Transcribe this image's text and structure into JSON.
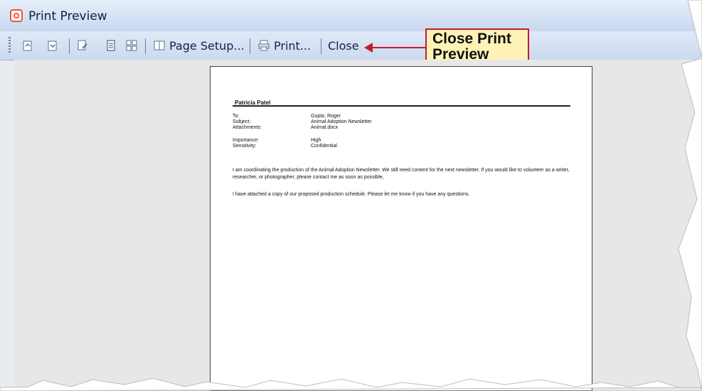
{
  "window": {
    "title": "Print Preview"
  },
  "toolbar": {
    "page_setup_label": "Page Setup...",
    "print_label": "Print...",
    "close_label": "Close"
  },
  "callout": {
    "text_line1": "Close Print",
    "text_line2": "Preview"
  },
  "document": {
    "author": "Patricia Patel",
    "fields": [
      {
        "label": "To:",
        "value": "Gupta, Roger"
      },
      {
        "label": "Subject:",
        "value": "Animal Adoption Newsletter"
      },
      {
        "label": "Attachments:",
        "value": "Animal.docx"
      },
      {
        "label": "Importance:",
        "value": "High"
      },
      {
        "label": "Sensitivity:",
        "value": "Confidential"
      }
    ],
    "paragraph1": "I am coordinating the production of the Animal Adoption Newsletter. We still need content for the next newsletter. If you would like to volunteer as a writer, researcher, or photographer, please contact me as soon as possible,",
    "paragraph2": "I have attached a copy of our proposed production schedule. Please let me know if you have any questions."
  },
  "icons": {
    "app": "print-preview-app-icon",
    "page_up": "previous-page-icon",
    "page_down": "next-page-icon",
    "view_one_page": "single-page-icon",
    "view_multi_page": "multiple-pages-icon",
    "page_setup": "page-setup-icon",
    "print": "printer-icon",
    "overflow": "overflow-chevron-icon"
  },
  "colors": {
    "titlebar_top": "#e6eefb",
    "titlebar_bottom": "#c9d8ef",
    "callout_border": "#c21d2a",
    "callout_fill": "#fff2b6",
    "active_button": "#ffb343"
  }
}
